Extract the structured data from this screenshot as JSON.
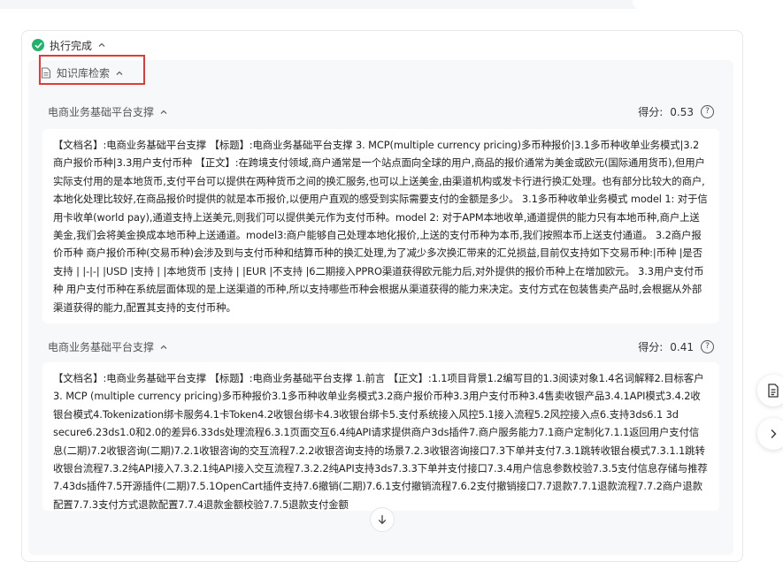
{
  "status": {
    "label": "执行完成"
  },
  "knowledge_search": {
    "label": "知识库检索"
  },
  "results": [
    {
      "title": "电商业务基础平台支撑",
      "score_label": "得分:",
      "score_value": "0.53",
      "content": "【文档名】:电商业务基础平台支撑 【标题】:电商业务基础平台支撑 3. MCP(multiple currency pricing)多币种报价|3.1多币种收单业务模式|3.2商户报价币种|3.3用户支付币种 【正文】:在跨境支付领域,商户通常是一个站点面向全球的用户,商品的报价通常为美金或欧元(国际通用货币),但用户实际支付用的是本地货币,支付平台可以提供在两种货币之间的换汇服务,也可以上送美金,由渠道机构或发卡行进行换汇处理。也有部分比较大的商户,本地化处理比较好,在商品报价时提供的就是本币报价,以便用户直观的感受到实际需要支付的金额是多少。 3.1多币种收单业务模式 model 1: 对于信用卡收单(world pay),通道支持上送美元,则我们可以提供美元作为支付币种。model 2: 对于APM本地收单,通道提供的能力只有本地币种,商户上送美金,我们会将美金换成本地币种上送通道。model3:商户能够自己处理本地化报价,上送的支付币种为本币,我们按照本币上送支付通道。 3.2商户报价币种 商户报价币种(交易币种)会涉及到与支付币种和结算币种的换汇处理,为了减少多次换汇带来的汇兑损益,目前仅支持如下交易币种:|币种 |是否支持 | |-|-| |USD |支持 | |本地货币 |支持 | |EUR |不支持 |6二期接入PPRO渠道获得欧元能力后,对外提供的报价币种上在增加欧元。 3.3用户支付币种 用户支付币种在系统层面体现的是上送渠道的币种,所以支持哪些币种会根据从渠道获得的能力来决定。支付方式在包装售卖产品时,会根据从外部渠道获得的能力,配置其支持的支付币种。"
    },
    {
      "title": "电商业务基础平台支撑",
      "score_label": "得分:",
      "score_value": "0.41",
      "content": "【文档名】:电商业务基础平台支撑 【标题】:电商业务基础平台支撑 1.前言 【正文】:1.1项目背景1.2编写目的1.3阅读对象1.4名词解释2.目标客户3. MCP (multiple currency pricing)多币种报价3.1多币种收单业务模式3.2商户报价币种3.3用户支付币种3.4售卖收银产品3.4.1API模式3.4.2收银台模式4.Tokenization绑卡服务4.1卡Token4.2收银台绑卡4.3收银台绑卡5.支付系统接入风控5.1接入流程5.2风控接入点6.支持3ds6.1 3d secure6.23ds1.0和2.0的差异6.33ds处理流程6.3.1页面交互6.4纯API请求提供商户3ds插件7.商户服务能力7.1商户定制化7.1.1返回用户支付信息(二期)7.2收银咨询(二期)7.2.1收银咨询的交互流程7.2.2收银咨询支持的场景7.2.3收银咨询接口7.3下单并支付7.3.1跳转收银台模式7.3.1.1跳转收银台流程7.3.2纯API接入7.3.2.1纯API接入交互流程7.3.2.2纯API支持3ds7.3.3下单并支付接口7.3.4用户信息参数校验7.3.5支付信息存储与推荐7.43ds插件7.5开源插件(二期)7.5.1OpenCart插件支持7.6撤销(二期)7.6.1支付撤销流程7.6.2支付撤销接口7.7退款7.7.1退款流程7.7.2商户退款配置7.7.3支付方式退款配置7.7.4退款金额校验7.7.5退款支付金额"
    }
  ],
  "icons": {
    "status": "check-circle-icon",
    "collapse": "chevron-up-icon",
    "document": "document-icon",
    "help": "question-circle-icon",
    "side_doc": "document-lines-icon",
    "side_next": "chevron-right-icon",
    "scroll_down": "arrow-down-icon"
  },
  "colors": {
    "success": "#22b36b",
    "highlight_border": "#e53935"
  }
}
